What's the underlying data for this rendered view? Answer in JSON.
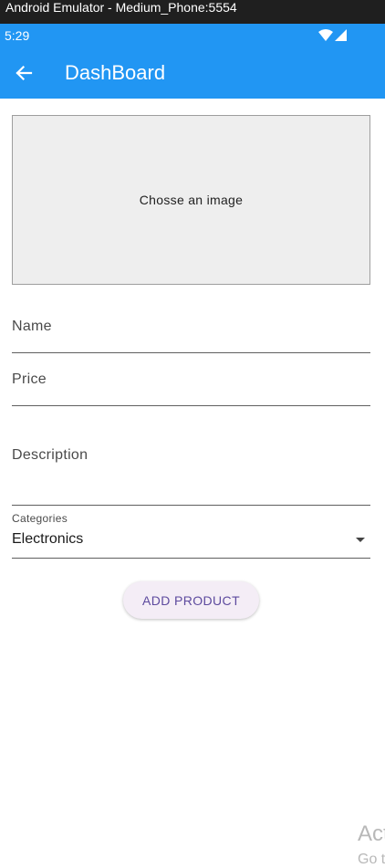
{
  "window": {
    "title": "Android Emulator - Medium_Phone:5554"
  },
  "status_bar": {
    "time": "5:29",
    "icons": [
      "wifi-icon",
      "signal-icon"
    ]
  },
  "app_bar": {
    "back_icon": "arrow-left-icon",
    "title": "DashBoard",
    "background": "#2196f3"
  },
  "form": {
    "image_picker_label": "Chosse an image",
    "name_label": "Name",
    "price_label": "Price",
    "description_label": "Description",
    "category": {
      "label": "Categories",
      "selected": "Electronics"
    },
    "submit_label": "ADD PRODUCT"
  },
  "watermark": {
    "line1": "Act",
    "line2": "Go t"
  }
}
